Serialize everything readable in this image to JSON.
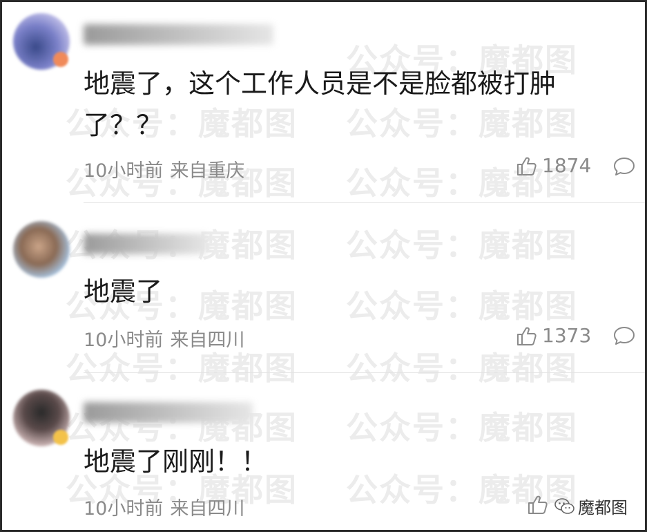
{
  "watermark": {
    "text1": "公众号：",
    "text2": "魔都图"
  },
  "comments": [
    {
      "text": "地震了，这个工作人员是不是脸都被打肿了？？",
      "time": "10小时前",
      "location": "来自重庆",
      "likes": "1874"
    },
    {
      "text": "地震了",
      "time": "10小时前",
      "location": "来自四川",
      "likes": "1373"
    },
    {
      "text": "地震了刚刚！！",
      "time": "10小时前",
      "location": "来自四川",
      "likes": ""
    }
  ],
  "brand": {
    "label": "魔都图"
  },
  "icons": {
    "like": "thumbs-up-icon",
    "reply": "comment-bubble-icon",
    "brand": "wechat-logo-icon"
  }
}
